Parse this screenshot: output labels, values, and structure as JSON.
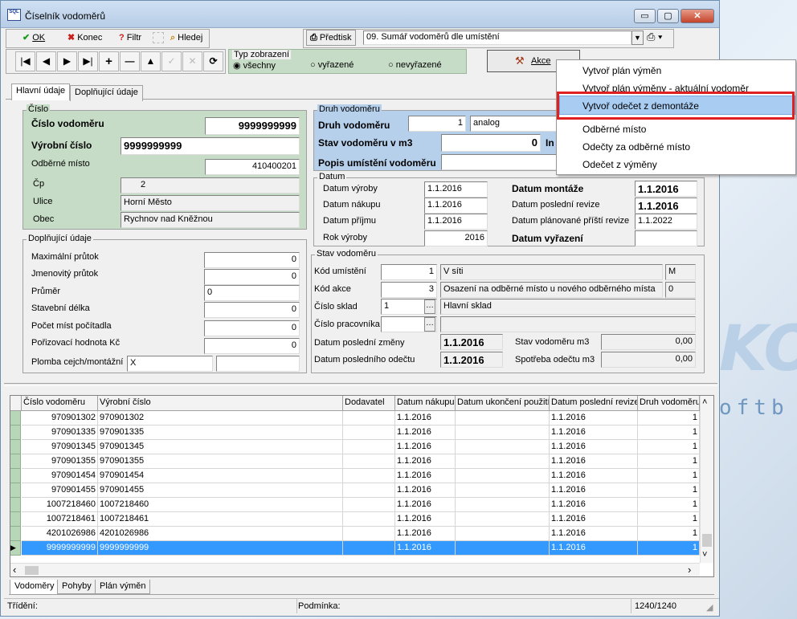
{
  "window": {
    "title": "Číselník vodoměrů",
    "minimize": "▭",
    "maximize": "▢",
    "close": "✕"
  },
  "bg": {
    "logo": "KO",
    "soft": "oftb"
  },
  "toolbar": {
    "ok": "OK",
    "ok_icon": "✔",
    "konec": "Konec",
    "konec_icon": "✖",
    "filtr": "Filtr",
    "filtr_icon": "?",
    "hledej": "Hledej",
    "predtisk": "Předtisk",
    "report": "09. Sumář vodoměrů dle umístění"
  },
  "nav": {
    "first": "|◀",
    "prev": "◀",
    "next": "▶",
    "last": "▶|",
    "add": "+",
    "delete": "—",
    "up": "▲",
    "check": "✓",
    "cancel": "✕",
    "refresh": "⟳"
  },
  "view_type": {
    "label": "Typ zobrazení",
    "options": [
      "všechny",
      "vyřazené",
      "nevyřazené"
    ],
    "selected": "všechny"
  },
  "akce": {
    "label": "Akce"
  },
  "tabs_top": [
    "Hlavní údaje",
    "Doplňující údaje"
  ],
  "cislo_group": {
    "label": "Číslo",
    "cislo_vodomeru_label": "Číslo vodoměru",
    "cislo_vodomeru": "9999999999",
    "vyrobni_cislo_label": "Výrobní číslo",
    "vyrobni_cislo": "9999999999",
    "odberne_misto_label": "Odběrné místo",
    "odberne_misto": "410400201",
    "cp_label": "Čp",
    "cp": "2",
    "ulice_label": "Ulice",
    "ulice": "Horní Město",
    "obec_label": "Obec",
    "obec": "Rychnov nad Kněžnou"
  },
  "druh_group": {
    "label": "Druh vodoměru",
    "druh_label": "Druh vodoměru",
    "druh": "1",
    "druh_name": "analog",
    "stav_label": "Stav vodoměru v m3",
    "stav": "0",
    "stav_suffix": "In",
    "popis_label": "Popis umístění vodoměru"
  },
  "dopl_group": {
    "label": "Doplňující údaje",
    "rows": [
      {
        "label": "Maximální průtok",
        "value": "0"
      },
      {
        "label": "Jmenovitý průtok",
        "value": "0"
      },
      {
        "label": "Průměr",
        "value": "0"
      },
      {
        "label": "Stavební délka",
        "value": "0"
      },
      {
        "label": "Počet míst počítadla",
        "value": "0"
      },
      {
        "label": "Pořizovací hodnota Kč",
        "value": "0"
      }
    ],
    "plomba_label": "Plomba cejch/montážní",
    "plomba": "X"
  },
  "datum_group": {
    "label": "Datum",
    "vyroby_label": "Datum výroby",
    "vyroby": "1.1.2016",
    "nakupu_label": "Datum nákupu",
    "nakupu": "1.1.2016",
    "prijmu_label": "Datum příjmu",
    "prijmu": "1.1.2016",
    "rok_label": "Rok výroby",
    "rok": "2016",
    "montaze_label": "Datum montáže",
    "montaze": "1.1.2016",
    "revize_label": "Datum poslední revize",
    "revize": "1.1.2016",
    "pristi_label": "Datum plánované příští revize",
    "pristi": "1.1.2022",
    "vyrazeni_label": "Datum vyřazení"
  },
  "stav_group": {
    "label": "Stav vodoměru",
    "kod_umisteni_label": "Kód umístění",
    "kod_umisteni": "1",
    "kod_umisteni_name": "V síti",
    "kod_umisteni_code": "M",
    "kod_akce_label": "Kód akce",
    "kod_akce": "3",
    "kod_akce_name": "Osazení na odběrné místo u nového odběrného místa",
    "kod_akce_code": "0",
    "sklad_label": "Číslo sklad",
    "sklad": "1",
    "sklad_name": "Hlavní sklad",
    "pracovnik_label": "Číslo pracovníka",
    "dots": "…",
    "posl_zmeny_label": "Datum poslední změny",
    "posl_zmeny": "1.1.2016",
    "posl_odectu_label": "Datum posledního odečtu",
    "posl_odectu": "1.1.2016",
    "stav_m3_label": "Stav vodoměru m3",
    "stav_m3": "0,00",
    "spotreba_label": "Spotřeba odečtu m3",
    "spotreba": "0,00"
  },
  "menu": {
    "items": [
      "Vytvoř plán výměn",
      "Vytvoř plán výměny - aktuální vodoměr",
      "Vytvoř odečet z demontáže",
      "Odběrné místo",
      "Odečty za odběrné místo",
      "Odečet z výměny"
    ],
    "highlighted": "Vytvoř odečet z demontáže"
  },
  "grid": {
    "columns": [
      "Číslo vodoměru",
      "Výrobní číslo",
      "Dodavatel",
      "Datum nákupu",
      "Datum ukončení použití",
      "Datum poslední revize",
      "Druh vodoměru"
    ],
    "rows": [
      [
        "970901302",
        "970901302",
        "",
        "1.1.2016",
        "",
        "1.1.2016",
        "1"
      ],
      [
        "970901335",
        "970901335",
        "",
        "1.1.2016",
        "",
        "1.1.2016",
        "1"
      ],
      [
        "970901345",
        "970901345",
        "",
        "1.1.2016",
        "",
        "1.1.2016",
        "1"
      ],
      [
        "970901355",
        "970901355",
        "",
        "1.1.2016",
        "",
        "1.1.2016",
        "1"
      ],
      [
        "970901454",
        "970901454",
        "",
        "1.1.2016",
        "",
        "1.1.2016",
        "1"
      ],
      [
        "970901455",
        "970901455",
        "",
        "1.1.2016",
        "",
        "1.1.2016",
        "1"
      ],
      [
        "1007218460",
        "1007218460",
        "",
        "1.1.2016",
        "",
        "1.1.2016",
        "1"
      ],
      [
        "1007218461",
        "1007218461",
        "",
        "1.1.2016",
        "",
        "1.1.2016",
        "1"
      ],
      [
        "4201026986",
        "4201026986",
        "",
        "1.1.2016",
        "",
        "1.1.2016",
        "1"
      ],
      [
        "9999999999",
        "9999999999",
        "",
        "1.1.2016",
        "",
        "1.1.2016",
        "1"
      ]
    ],
    "selected_row": 9,
    "scroll_left": "‹",
    "scroll_right": "›",
    "scroll_up": "˄",
    "scroll_down": "˅"
  },
  "tabs_bottom": [
    "Vodoměry",
    "Pohyby",
    "Plán výměn"
  ],
  "status": {
    "trideni": "Třídění:",
    "podminka": "Podmínka:",
    "count": "1240/1240"
  }
}
